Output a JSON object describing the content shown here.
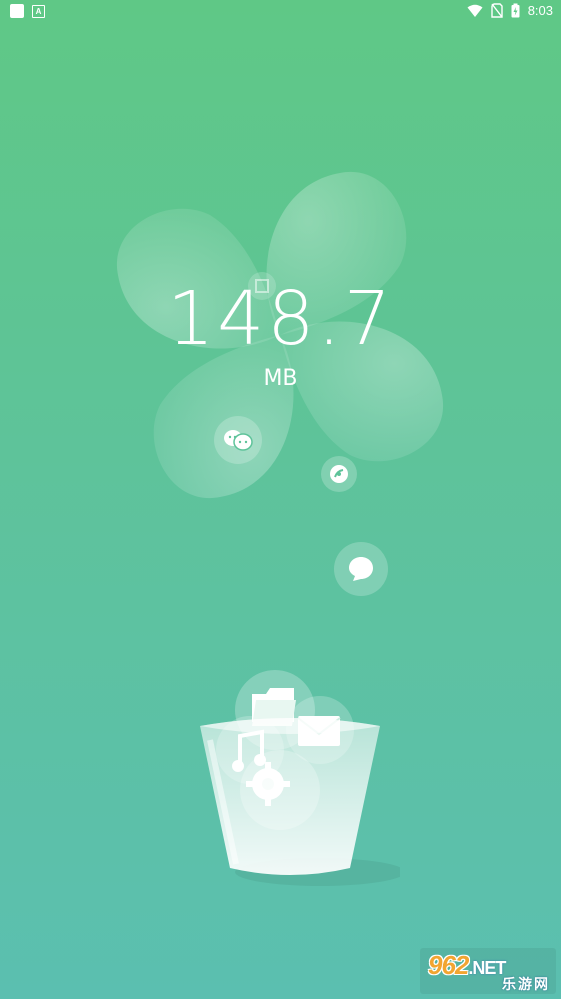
{
  "status_bar": {
    "time": "8:03",
    "icons": [
      "app-notification-icon",
      "a-notification-icon",
      "wifi-icon",
      "no-sim-icon",
      "battery-charging-icon"
    ]
  },
  "cleaner": {
    "size_value": "148.7",
    "size_unit": "MB"
  },
  "floating_icons": [
    "chat-faces-icon",
    "music-disc-icon",
    "message-bubble-icon"
  ],
  "bin_contents": [
    "folder-icon",
    "mail-icon",
    "music-note-icon",
    "gear-icon"
  ],
  "watermark": {
    "top": "962",
    "net": ".NET",
    "bottom": "乐游网"
  },
  "colors": {
    "bg_top": "#5fc886",
    "bg_bottom": "#5bbfb0",
    "foreground": "#ffffff"
  }
}
